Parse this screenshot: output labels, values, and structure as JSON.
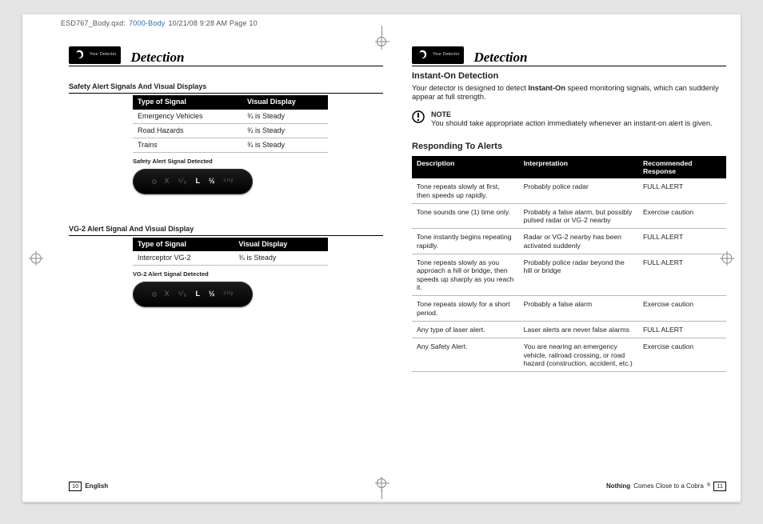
{
  "print_header": {
    "file": "ESD767_Body.qxd:",
    "blue": "7000-Body",
    "rest": "  10/21/08  9:28 AM  Page 10"
  },
  "logo_tiny": "Your Detector",
  "page_title": "Detection",
  "left": {
    "section1_title": "Safety Alert Signals And Visual Displays",
    "table1_h1": "Type of Signal",
    "table1_h2": "Visual Display",
    "table1_rows": [
      {
        "c1": "Emergency Vehicles",
        "c2": "¾ is Steady"
      },
      {
        "c1": "Road Hazards",
        "c2": "¾ is Steady"
      },
      {
        "c1": "Trains",
        "c2": "¾ is Steady"
      }
    ],
    "caption1": "Safety Alert Signal Detected",
    "pill_display": [
      {
        "t": "•",
        "cls": "dot"
      },
      {
        "t": "X",
        "cls": "dim"
      },
      {
        "t": "⁵⁄₆",
        "cls": "dim"
      },
      {
        "t": "L",
        "cls": "bold"
      },
      {
        "t": "½",
        "cls": "bold"
      },
      {
        "t": "city",
        "cls": "dim"
      }
    ],
    "section2_title": "VG-2 Alert Signal And Visual Display",
    "table2_h1": "Type of Signal",
    "table2_h2": "Visual Display",
    "table2_rows": [
      {
        "c1": "Interceptor VG-2",
        "c2": "¾ is Steady"
      }
    ],
    "caption2": "VG-2 Alert Signal Detected",
    "foot_num": "10",
    "foot_label": "English"
  },
  "right": {
    "instant_title": "Instant-On Detection",
    "instant_body_pre": "Your detector is designed to detect ",
    "instant_body_bold": "Instant-On",
    "instant_body_post": " speed monitoring signals, which can suddenly appear at full strength.",
    "note_label": "NOTE",
    "note_body": "You should take appropriate action immediately whenever an instant-on alert is given.",
    "resp_title": "Responding To Alerts",
    "resp_h1": "Description",
    "resp_h2": "Interpretation",
    "resp_h3": "Recommended Response",
    "resp_rows": [
      {
        "c1": "Tone repeats slowly at first, then speeds up rapidly.",
        "c2": "Probably police radar",
        "c3": "FULL ALERT"
      },
      {
        "c1": "Tone sounds one (1) time only.",
        "c2": "Probably a false alarm, but possibly pulsed radar or VG-2 nearby",
        "c3": "Exercise caution"
      },
      {
        "c1": "Tone instantly begins repeating rapidly.",
        "c2": "Radar or VG-2 nearby has been activated suddenly",
        "c3": "FULL ALERT"
      },
      {
        "c1": "Tone repeats slowly as you approach a hill or bridge, then speeds up sharply as you reach it.",
        "c2": "Probably police radar beyond the hill or bridge",
        "c3": "FULL ALERT"
      },
      {
        "c1": "Tone repeats slowly for a short period.",
        "c2": "Probably a false alarm",
        "c3": "Exercise caution"
      },
      {
        "c1": "Any type of laser alert.",
        "c2": "Laser alerts are never false alarms",
        "c3": "FULL ALERT"
      },
      {
        "c1": "Any Safety Alert.",
        "c2": "You are nearing an emergency vehicle, railroad crossing, or road hazard (construction, accident, etc.)",
        "c3": "Exercise caution"
      }
    ],
    "foot_bold": "Nothing",
    "foot_rest": " Comes Close to a Cobra",
    "foot_num": "11"
  }
}
